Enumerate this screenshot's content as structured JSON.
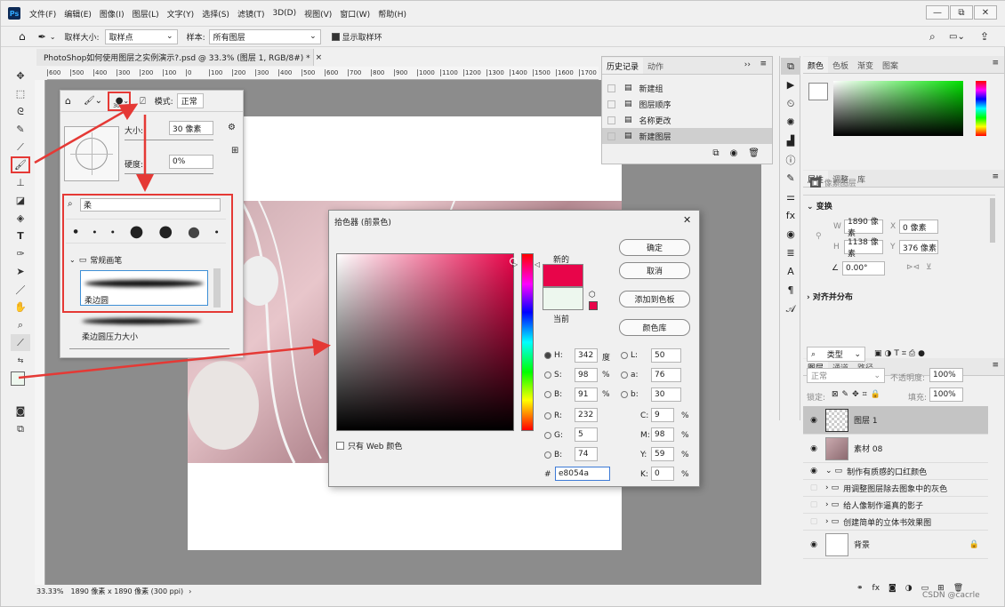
{
  "menubar": {
    "logo": "Ps",
    "items": [
      "文件(F)",
      "编辑(E)",
      "图像(I)",
      "图层(L)",
      "文字(Y)",
      "选择(S)",
      "滤镜(T)",
      "3D(D)",
      "视图(V)",
      "窗口(W)",
      "帮助(H)"
    ],
    "win_min": "—",
    "win_restore": "⧉",
    "win_close": "✕"
  },
  "options": {
    "sample_size_label": "取样大小:",
    "sample_size_value": "取样点",
    "sample_label": "样本:",
    "sample_value": "所有图层",
    "show_ring_label": "显示取样环"
  },
  "document": {
    "tab_title": "PhotoShop如何使用图层之实例演示?.psd @ 33.3% (图层 1, RGB/8#) *",
    "tab_close": "×",
    "ruler_ticks": [
      "600",
      "500",
      "400",
      "300",
      "200",
      "100",
      "0",
      "100",
      "200",
      "300",
      "400",
      "500",
      "600",
      "700",
      "800",
      "900",
      "1000",
      "1100",
      "1200",
      "1300",
      "1400",
      "1500",
      "1600",
      "1700"
    ],
    "status_zoom": "33.33%",
    "status_info": "1890 像素 x 1890 像素 (300 ppi)",
    "status_arrow": "›"
  },
  "brush_panel": {
    "mode_label": "模式:",
    "mode_value": "正常",
    "size_number": "30",
    "size_label": "大小:",
    "size_value": "30 像素",
    "hardness_label": "硬度:",
    "hardness_value": "0%",
    "search_value": "柔",
    "group_name": "常规画笔",
    "brush_1": "柔边圆",
    "brush_2": "柔边圆压力大小"
  },
  "history": {
    "tabs": [
      "历史记录",
      "动作"
    ],
    "expand": "››",
    "items": [
      "新建组",
      "图层顺序",
      "名称更改",
      "新建图层"
    ]
  },
  "picker": {
    "title": "拾色器 (前景色)",
    "close": "✕",
    "new_label": "新的",
    "current_label": "当前",
    "ok": "确定",
    "cancel": "取消",
    "add_swatch": "添加到色板",
    "library": "颜色库",
    "web_only": "只有 Web 颜色",
    "H": "342",
    "H_unit": "度",
    "S": "98",
    "S_unit": "%",
    "B": "91",
    "B_unit": "%",
    "R": "232",
    "G": "5",
    "Bv": "74",
    "L": "50",
    "a": "76",
    "b": "30",
    "C": "9",
    "M": "98",
    "Y": "59",
    "K": "0",
    "pct": "%",
    "hex_label": "#",
    "hex": "e8054a",
    "labels": {
      "H": "H:",
      "S": "S:",
      "B": "B:",
      "R": "R:",
      "G": "G:",
      "Bl": "B:",
      "L": "L:",
      "a": "a:",
      "b": "b:",
      "C": "C:",
      "M": "M:",
      "Y": "Y:",
      "K": "K:"
    }
  },
  "color_panel": {
    "tabs": [
      "颜色",
      "色板",
      "渐变",
      "图案"
    ]
  },
  "properties_panel": {
    "tabs": [
      "属性",
      "调整",
      "库"
    ],
    "kind": "像素图层",
    "transform_title": "变换",
    "W_label": "W",
    "W": "1890 像素",
    "X_label": "X",
    "X": "0 像素",
    "H_label": "H",
    "H": "1138 像素",
    "Y_label": "Y",
    "Y": "376 像素",
    "angle": "0.00°",
    "align_title": "对齐并分布"
  },
  "layers_panel": {
    "tabs": [
      "图层",
      "通道",
      "路径"
    ],
    "filter_value": "类型",
    "blend_mode": "正常",
    "opacity_label": "不透明度:",
    "opacity": "100%",
    "lock_label": "锁定:",
    "fill_label": "填充:",
    "fill": "100%",
    "layers": [
      {
        "name": "图层 1"
      },
      {
        "name": "素材 08"
      },
      {
        "name": "制作有质感的口红颜色"
      },
      {
        "name": "用调整图层除去图象中的灰色"
      },
      {
        "name": "给人像制作逼真的影子"
      },
      {
        "name": "创建简单的立体书效果图"
      },
      {
        "name": "背景"
      }
    ]
  },
  "watermark": "CSDN @cacrle",
  "colors": {
    "accent_red": "#e53935",
    "new_color": "#e8054a",
    "current_color": "#edf7ee"
  }
}
